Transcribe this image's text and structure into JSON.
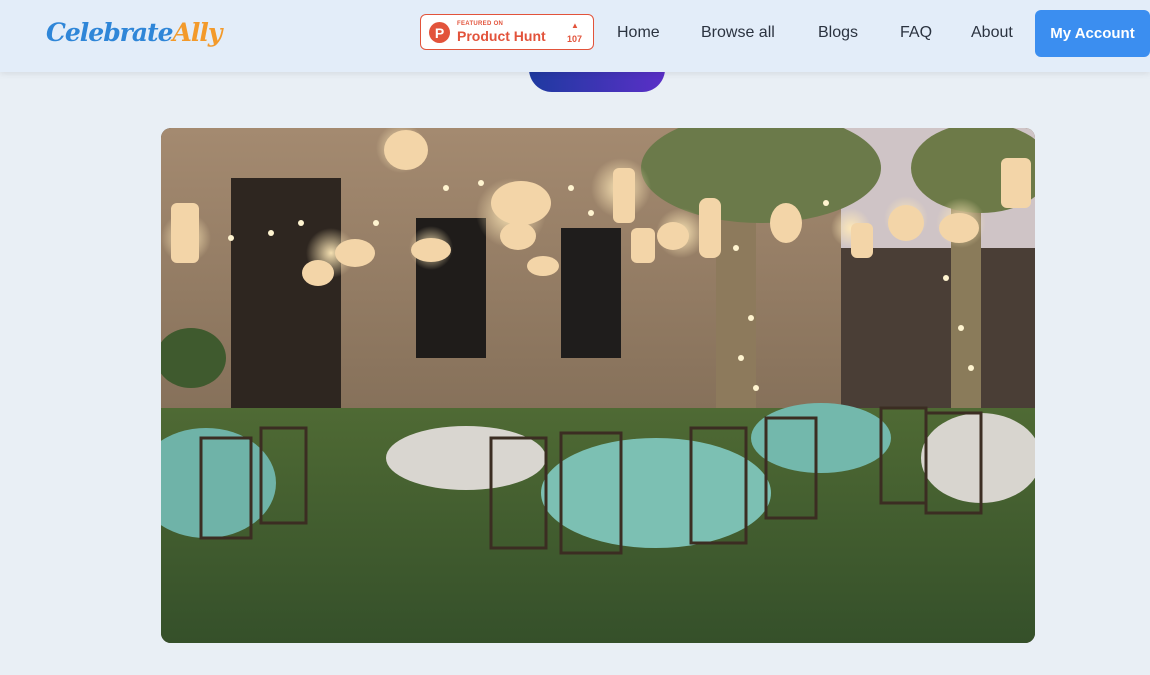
{
  "logo": {
    "part1": "Celebrate",
    "part2": "Ally"
  },
  "product_hunt": {
    "featured": "FEATURED ON",
    "name": "Product Hunt",
    "count": "107",
    "letter": "P"
  },
  "nav": [
    {
      "label": "Home"
    },
    {
      "label": "Browse all"
    },
    {
      "label": "Blogs"
    },
    {
      "label": "FAQ"
    },
    {
      "label": "About"
    }
  ],
  "account_button": "My Account",
  "colors": {
    "accent": "#3b8ef0",
    "product_hunt": "#e2533b",
    "background": "#e9eff5"
  }
}
